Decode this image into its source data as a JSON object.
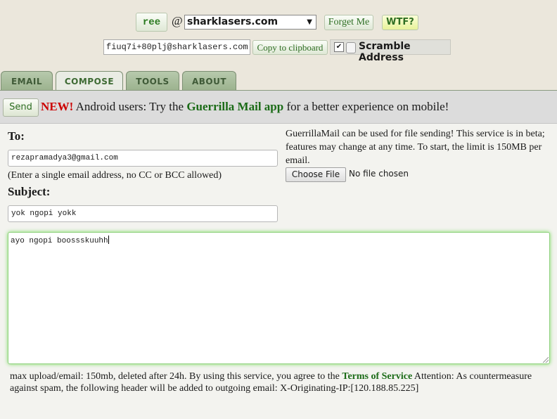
{
  "header": {
    "username": "ree",
    "at": "@",
    "domain": "sharklasers.com",
    "forget_label": "Forget Me",
    "wtf_label": "WTF?",
    "email_address": "fiuq7i+80plj@sharklasers.com",
    "copy_label": "Copy to clipboard",
    "scramble_label": "Scramble Address",
    "scramble_checked": true
  },
  "tabs": [
    {
      "label": "EMAIL",
      "active": false
    },
    {
      "label": "COMPOSE",
      "active": true
    },
    {
      "label": "TOOLS",
      "active": false
    },
    {
      "label": "ABOUT",
      "active": false
    }
  ],
  "compose": {
    "send_label": "Send",
    "notice_new": "NEW!",
    "notice_text_1": " Android users: Try the ",
    "notice_app": "Guerrilla Mail app",
    "notice_text_2": " for a better experience on mobile!",
    "to_label": "To:",
    "to_value": "rezapramadya3@gmail.com",
    "to_hint": "(Enter a single email address, no CC or BCC allowed)",
    "subject_label": "Subject:",
    "subject_value": "yok ngopi yokk",
    "file_info": "GuerrillaMail can be used for file sending! This service is in beta; features may change at any time. To start, the limit is 150MB per email.",
    "choose_file_label": "Choose File",
    "no_file_label": "No file chosen",
    "message_body": "ayo ngopi boossskuuhh",
    "footer_text_1": "max upload/email: 150mb, deleted after 24h. By using this service, you agree to the ",
    "footer_tos": "Terms of Service",
    "footer_text_2": " Attention: As countermeasure against spam, the following header will be added to outgoing email: X-Originating-IP:[120.188.85.225]"
  },
  "colors": {
    "accent_green": "#1b6b17",
    "new_red": "#cc0000",
    "background": "#ebe7dc"
  }
}
